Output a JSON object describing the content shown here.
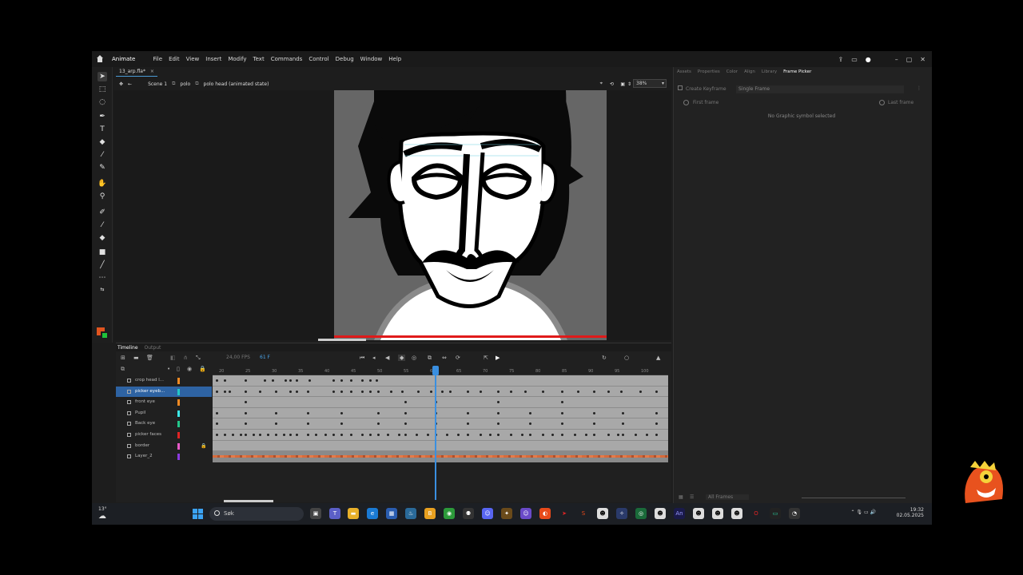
{
  "menubar": {
    "app_name": "Animate",
    "items": [
      "File",
      "Edit",
      "View",
      "Insert",
      "Modify",
      "Text",
      "Commands",
      "Control",
      "Debug",
      "Window",
      "Help"
    ]
  },
  "document": {
    "tab_label": "13_arp.fla*",
    "close_glyph": "×"
  },
  "editbar": {
    "scene": "Scene 1",
    "symbol": "polo",
    "state": "polo head (animated state)",
    "zoom": "38%"
  },
  "timeline": {
    "tab_timeline": "Timeline",
    "tab_output": "Output",
    "fps": "24,00 FPS",
    "current_frame": "61 F",
    "ruler_ticks": [
      "20",
      "25",
      "30",
      "35",
      "40",
      "45",
      "50",
      "55",
      "60",
      "65",
      "70",
      "75",
      "80",
      "85",
      "90",
      "95",
      "100"
    ],
    "layers": [
      {
        "name": "crop head l...",
        "color": "#f08a24",
        "selected": false,
        "locked": false
      },
      {
        "name": "picker eyeb...",
        "color": "#23c6c6",
        "selected": true,
        "locked": false
      },
      {
        "name": "front eye",
        "color": "#f08a24",
        "selected": false,
        "locked": false
      },
      {
        "name": "Pupil",
        "color": "#3ce8e8",
        "selected": false,
        "locked": false
      },
      {
        "name": "Back eye",
        "color": "#23c68a",
        "selected": false,
        "locked": false
      },
      {
        "name": "picker faces",
        "color": "#e02424",
        "selected": false,
        "locked": false
      },
      {
        "name": "border",
        "color": "#e85ac8",
        "selected": false,
        "locked": true
      },
      {
        "name": "Layer_2",
        "color": "#8a3ae0",
        "selected": false,
        "locked": false
      }
    ]
  },
  "panel": {
    "tabs": [
      "Assets",
      "Properties",
      "Color",
      "Align",
      "Library",
      "Frame Picker"
    ],
    "active_tab": "Frame Picker",
    "create_keyframe": "Create Keyframe",
    "mode": "Single Frame",
    "first_frame": "First frame",
    "last_frame": "Last frame",
    "empty_message": "No Graphic symbol selected",
    "footer_filter": "All Frames"
  },
  "taskbar": {
    "weather": "13°",
    "search_placeholder": "Søk",
    "time": "19:32",
    "date": "02.05.2025"
  },
  "colors": {
    "accent": "#3a8fe0",
    "fill_swatch": "#e0541f",
    "stroke_swatch": "#1fc23a"
  }
}
